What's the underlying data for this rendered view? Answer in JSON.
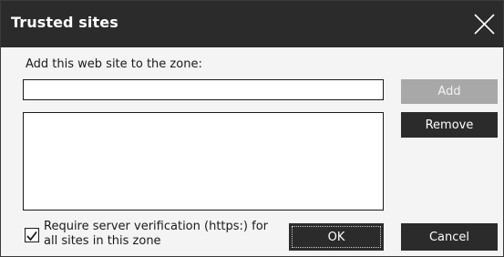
{
  "dialog": {
    "title": "Trusted sites",
    "close_icon": "close-icon"
  },
  "form": {
    "prompt_label": "Add this web site to the zone:",
    "site_input_value": "",
    "sites_list": []
  },
  "buttons": {
    "add_label": "Add",
    "remove_label": "Remove",
    "ok_label": "OK",
    "cancel_label": "Cancel"
  },
  "checkbox": {
    "checked": true,
    "label_line1": "Require server verification (https:) for",
    "label_line2": "all sites in this zone"
  },
  "colors": {
    "titlebar": "#2b2b2b",
    "button": "#2b2b2b",
    "button_disabled": "#a8a8a8",
    "background": "#f4f4f4"
  }
}
